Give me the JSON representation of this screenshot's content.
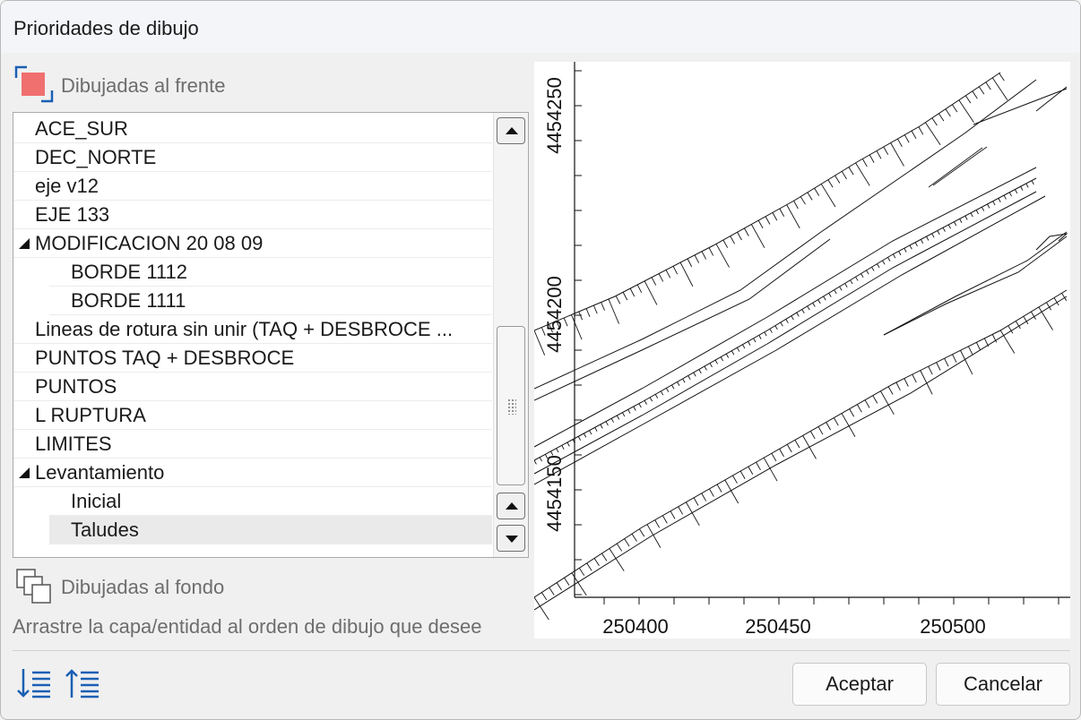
{
  "window": {
    "title": "Prioridades de dibujo"
  },
  "sections": {
    "front_label": "Dibujadas al frente",
    "back_label": "Dibujadas al fondo"
  },
  "layers": [
    {
      "label": "ACE_SUR",
      "indent": 0,
      "expander": false
    },
    {
      "label": "DEC_NORTE",
      "indent": 0,
      "expander": false
    },
    {
      "label": "eje v12",
      "indent": 0,
      "expander": false
    },
    {
      "label": "EJE 133",
      "indent": 0,
      "expander": false
    },
    {
      "label": "MODIFICACION 20 08 09",
      "indent": 0,
      "expander": true
    },
    {
      "label": "BORDE 1112",
      "indent": 1,
      "expander": false
    },
    {
      "label": "BORDE 1111",
      "indent": 1,
      "expander": false
    },
    {
      "label": "Lineas de rotura sin unir (TAQ + DESBROCE ...",
      "indent": 0,
      "expander": false
    },
    {
      "label": "PUNTOS TAQ + DESBROCE",
      "indent": 0,
      "expander": false
    },
    {
      "label": "PUNTOS",
      "indent": 0,
      "expander": false
    },
    {
      "label": "L RUPTURA",
      "indent": 0,
      "expander": false
    },
    {
      "label": "LIMITES",
      "indent": 0,
      "expander": false
    },
    {
      "label": "Levantamiento",
      "indent": 0,
      "expander": true
    },
    {
      "label": "Inicial",
      "indent": 1,
      "expander": false
    },
    {
      "label": "Taludes",
      "indent": 1,
      "expander": false,
      "selected": true
    }
  ],
  "hint": "Arrastre la capa/entidad al orden de dibujo que desee",
  "preview": {
    "y_ticks": [
      "4454250",
      "4454200",
      "4454150"
    ],
    "x_ticks": [
      "250400",
      "250450",
      "250500"
    ]
  },
  "buttons": {
    "accept": "Aceptar",
    "cancel": "Cancelar"
  },
  "icons": {
    "front": "bring-to-front-icon",
    "back": "send-to-back-icon",
    "sort_down": "sort-descending-icon",
    "sort_up": "sort-ascending-icon"
  },
  "colors": {
    "accent": "#1a5fb4",
    "front_fill": "#f07070"
  }
}
